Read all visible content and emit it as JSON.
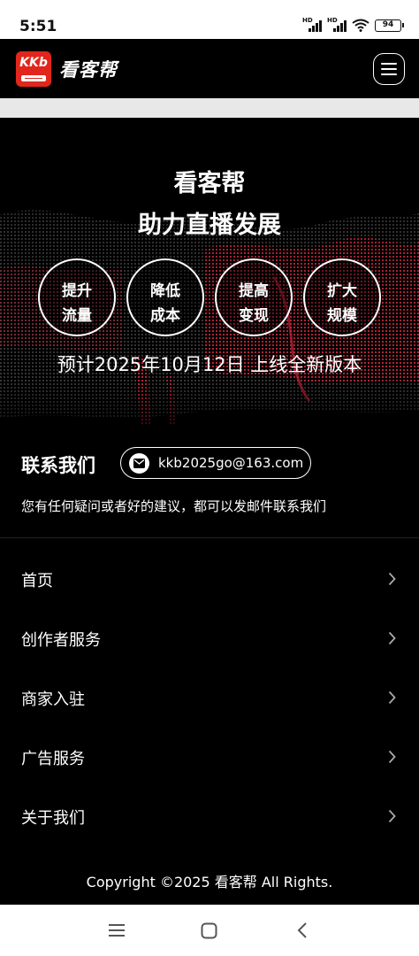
{
  "status_bar": {
    "time": "5:51",
    "hd_label": "HD",
    "battery": "94"
  },
  "header": {
    "logo_text": "KKb",
    "brand_name": "看客帮",
    "menu_icon": "hamburger-menu-icon"
  },
  "hero": {
    "title": "看客帮",
    "subtitle": "助力直播发展",
    "features": [
      {
        "line1": "提升",
        "line2": "流量"
      },
      {
        "line1": "降低",
        "line2": "成本"
      },
      {
        "line1": "提高",
        "line2": "变现"
      },
      {
        "line1": "扩大",
        "line2": "规模"
      }
    ],
    "notice": "预计2025年10月12日 上线全新版本"
  },
  "contact": {
    "title": "联系我们",
    "email_icon": "mail-icon",
    "email": "kkb2025go@163.com",
    "description": "您有任何疑问或者好的建议，都可以发邮件联系我们"
  },
  "nav": {
    "items": [
      {
        "label": "首页"
      },
      {
        "label": "创作者服务"
      },
      {
        "label": "商家入驻"
      },
      {
        "label": "广告服务"
      },
      {
        "label": "关于我们"
      }
    ]
  },
  "footer": {
    "copyright": "Copyright ©2025 看客帮 All Rights."
  },
  "colors": {
    "brand_red": "#e1261c",
    "background": "#000000",
    "accent_glow": "#d81f3c"
  }
}
